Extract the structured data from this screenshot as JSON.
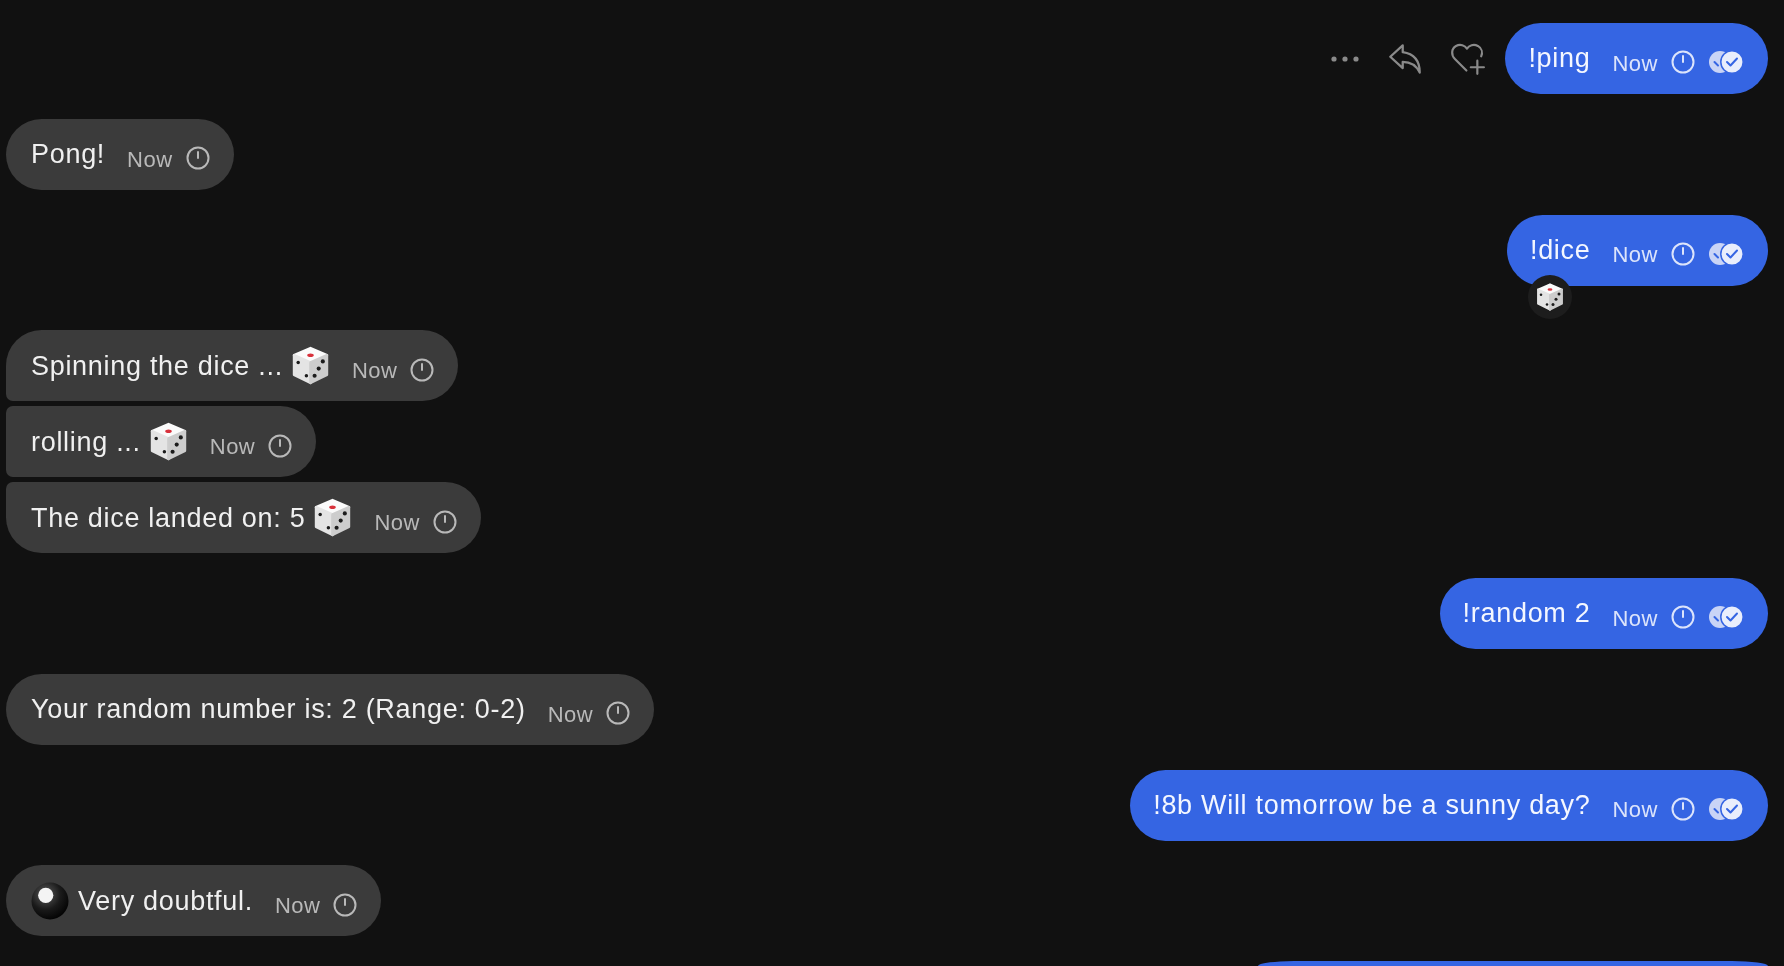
{
  "conversation": [
    {
      "kind": "outgoing",
      "hovered": true,
      "messages": [
        {
          "kind": "plain",
          "text": "!ping",
          "time": "Now"
        }
      ]
    },
    {
      "kind": "incoming",
      "hovered": false,
      "messages": [
        {
          "kind": "plain",
          "text": "Pong!",
          "time": "Now"
        }
      ]
    },
    {
      "kind": "outgoing",
      "hovered": false,
      "messages": [
        {
          "kind": "plain",
          "text": "!dice",
          "time": "Now",
          "reactions": [
            {
              "kind": "dice"
            }
          ]
        }
      ]
    },
    {
      "kind": "incoming",
      "hovered": false,
      "messages": [
        {
          "kind": "dice",
          "text": "Spinning the dice ...",
          "time": "Now"
        },
        {
          "kind": "dice",
          "text": "rolling ...",
          "time": "Now"
        },
        {
          "kind": "dice",
          "text": "The dice landed on: 5",
          "time": "Now"
        }
      ]
    },
    {
      "kind": "outgoing",
      "hovered": false,
      "messages": [
        {
          "kind": "plain",
          "text": "!random 2",
          "time": "Now"
        }
      ]
    },
    {
      "kind": "incoming",
      "hovered": false,
      "messages": [
        {
          "kind": "plain",
          "text": "Your random number is: 2 (Range: 0-2)",
          "time": "Now"
        }
      ]
    },
    {
      "kind": "outgoing",
      "hovered": false,
      "messages": [
        {
          "kind": "plain",
          "text": "!8b Will tomorrow be a sunny day?",
          "time": "Now"
        }
      ]
    },
    {
      "kind": "incoming",
      "hovered": false,
      "messages": [
        {
          "kind": "eight_ball",
          "text": "Very doubtful.",
          "time": "Now"
        }
      ]
    },
    {
      "kind": "outgoing",
      "hovered": false,
      "messages": [
        {
          "kind": "clipped"
        }
      ]
    }
  ]
}
